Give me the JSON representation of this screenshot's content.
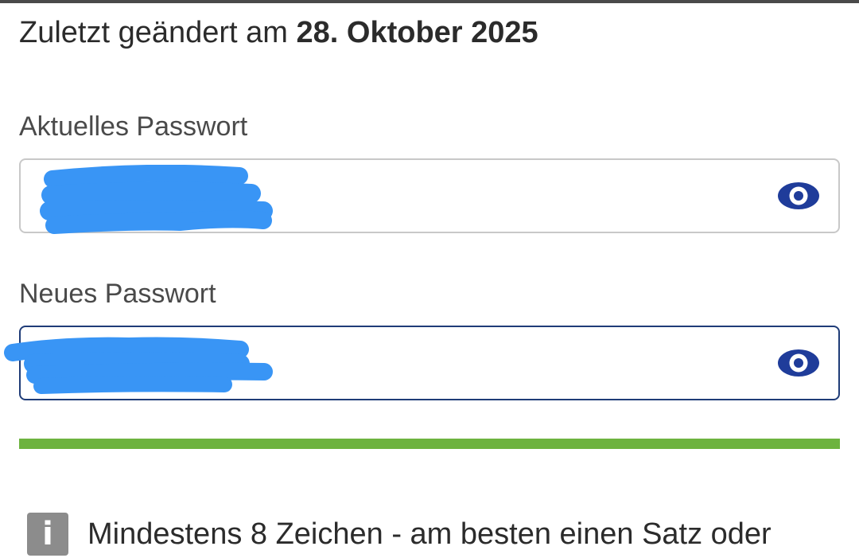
{
  "header": {
    "last_changed_prefix": "Zuletzt geändert am ",
    "last_changed_date": "28. Oktober 2025"
  },
  "current_password": {
    "label": "Aktuelles Passwort",
    "toggle_icon": "eye-icon"
  },
  "new_password": {
    "label": "Neues Passwort",
    "toggle_icon": "eye-icon"
  },
  "strength": {
    "level_percent": 100,
    "color": "#6db33f"
  },
  "hint": {
    "icon": "info-icon",
    "icon_glyph": "i",
    "text": "Mindestens 8 Zeichen - am besten einen Satz oder"
  },
  "colors": {
    "accent": "#1f3c78",
    "eye_icon": "#1f3c9a",
    "redaction": "#3995f5"
  }
}
